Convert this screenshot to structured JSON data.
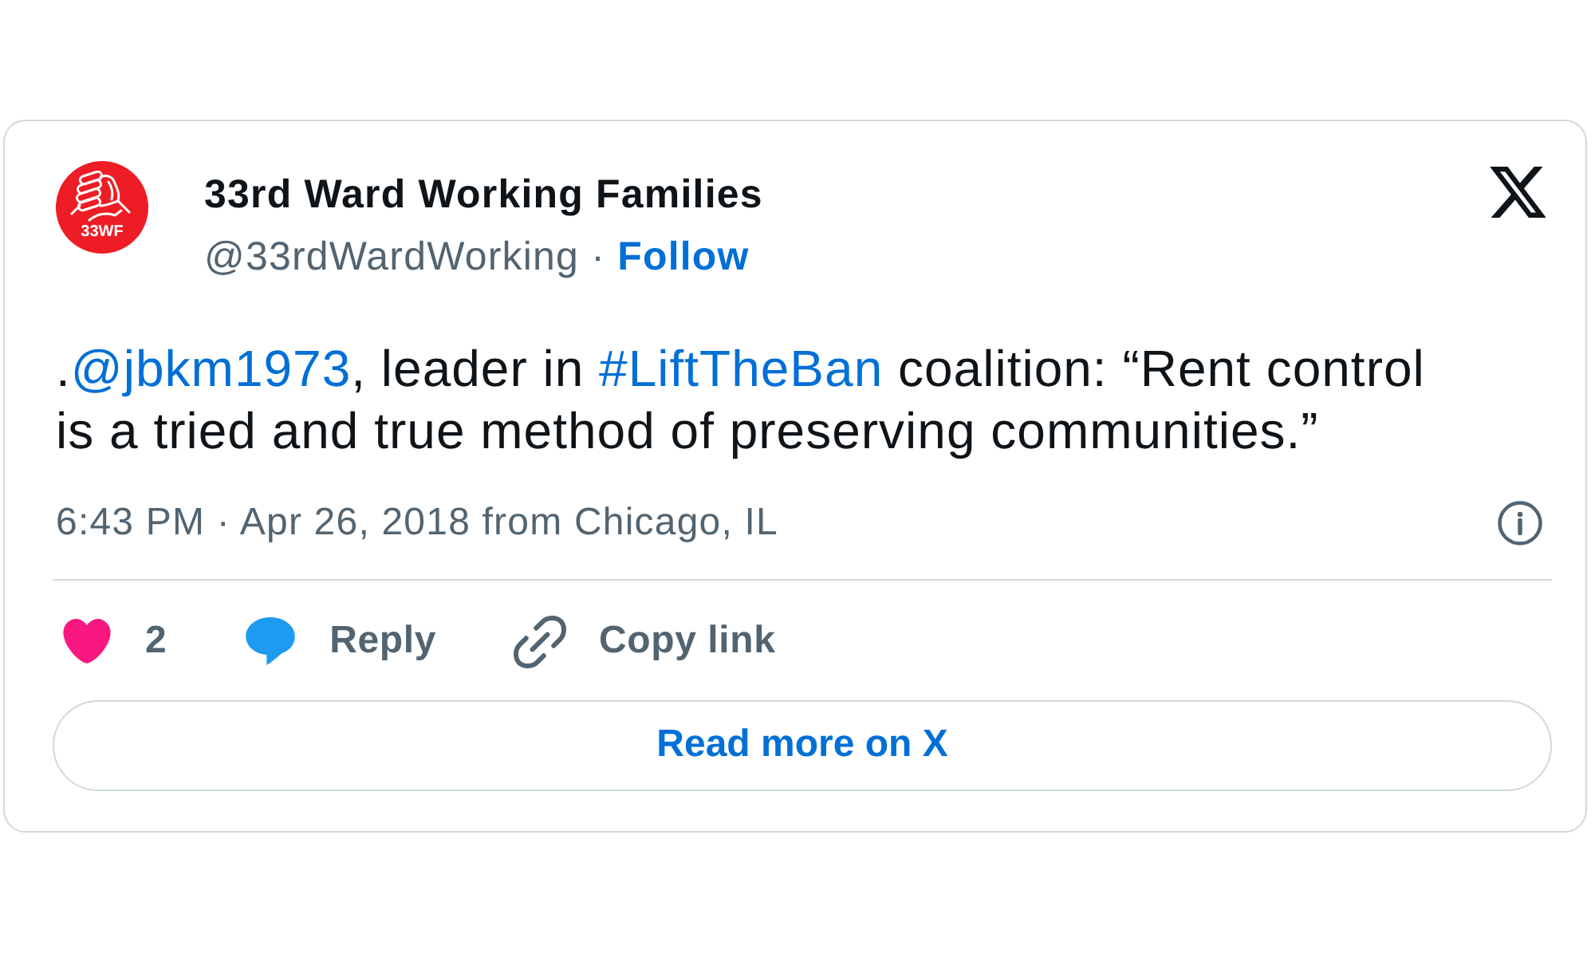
{
  "header": {
    "avatar_label": "33WF",
    "name": "33rd Ward Working Families",
    "handle": "@33rdWardWorking",
    "separator": "·",
    "follow": "Follow"
  },
  "tweet": {
    "segments": [
      {
        "kind": "text",
        "text": "."
      },
      {
        "kind": "mention",
        "text": "@jbkm1973"
      },
      {
        "kind": "text",
        "text": ", leader in "
      },
      {
        "kind": "hashtag",
        "text": "#LiftTheBan"
      },
      {
        "kind": "text",
        "text": " coalition: “Rent control is a tried and true method of preserving communities.”"
      }
    ],
    "timestamp": "6:43 PM · Apr 26, 2018 from Chicago, IL"
  },
  "actions": [
    {
      "kind": "like",
      "label": "2"
    },
    {
      "kind": "reply",
      "label": "Reply"
    },
    {
      "kind": "copy_link",
      "label": "Copy link"
    }
  ],
  "read_more": "Read more on X"
}
